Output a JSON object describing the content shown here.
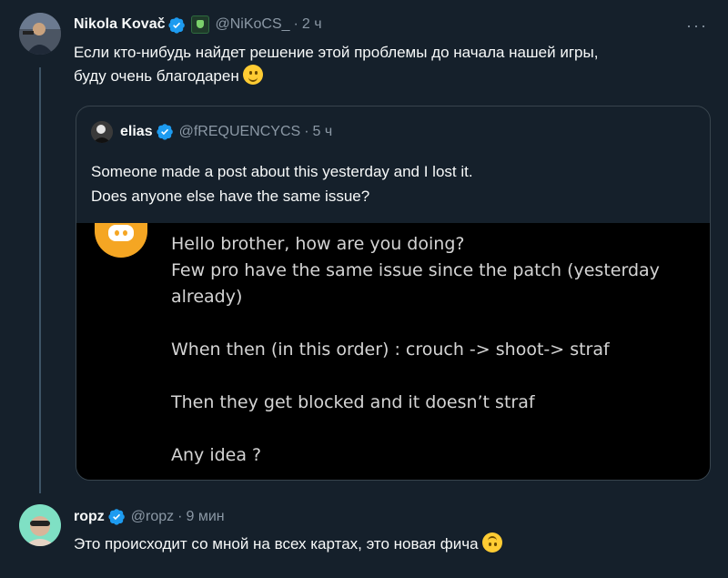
{
  "tweet1": {
    "name": "Nikola Kovač",
    "handle": "@NiKoCS_",
    "dot": "·",
    "time": "2 ч",
    "more": "···",
    "line1": "Если кто-нибудь найдет решение этой проблемы до начала нашей игры,",
    "line2": "буду очень благодарен",
    "emoji": "slightly-smiling-face"
  },
  "quote": {
    "name": "elias",
    "handle": "@fREQUENCYCS",
    "dot": "·",
    "time": "5 ч",
    "line1": "Someone made a post about this yesterday and I lost it.",
    "line2": "Does anyone else have the same issue?",
    "media_lines": [
      "Hello brother, how are you doing?",
      "Few pro have the same issue since the patch (yesterday",
      "already)",
      "When then (in this order) : crouch -> shoot-> straf",
      "Then they get blocked and it doesn’t straf",
      "Any idea ?"
    ]
  },
  "tweet2": {
    "name": "ropz",
    "handle": "@ropz",
    "dot": "·",
    "time": "9 мин",
    "text": "Это происходит со мной на всех картах, это новая фича",
    "emoji": "upside-down-face"
  },
  "colors": {
    "background": "#15202b",
    "verified": "#1d9bf0",
    "muted": "#8b98a5",
    "discord_accent": "#f5a623"
  }
}
